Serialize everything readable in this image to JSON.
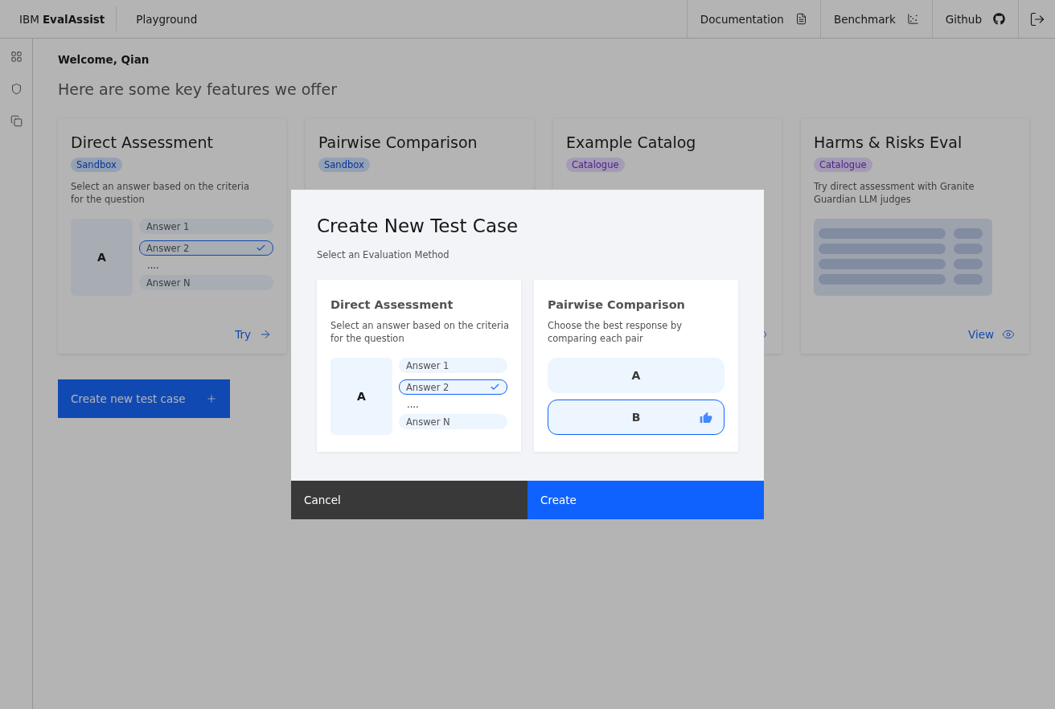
{
  "header": {
    "brand_prefix": "IBM",
    "brand_name": "EvalAssist",
    "nav": "Playground",
    "links": [
      {
        "label": "Documentation"
      },
      {
        "label": "Benchmark"
      },
      {
        "label": "Github"
      }
    ]
  },
  "sidebar": {
    "items": [
      {
        "selected": false
      },
      {
        "selected": false
      },
      {
        "selected": false
      }
    ]
  },
  "welcome": "Welcome, Qian",
  "subtitle": "Here are some key features we offer",
  "cards": [
    {
      "title": "Direct Assessment",
      "tag": {
        "label": "Sandbox",
        "kind": "sandbox"
      },
      "description": "Select an answer based on the criteria for the question",
      "preview": {
        "kind": "answers",
        "subject": "A",
        "answers_top": [
          {
            "label": "Answer 1",
            "selected": false
          },
          {
            "label": "Answer 2",
            "selected": true
          }
        ],
        "ellipsis": "....",
        "answers_bottom": [
          {
            "label": "Answer N",
            "selected": false
          }
        ]
      },
      "action": {
        "label": "Try",
        "kind": "try"
      }
    },
    {
      "title": "Pairwise Comparison",
      "tag": {
        "label": "Sandbox",
        "kind": "sandbox"
      }
    },
    {
      "title": "Example Catalog",
      "tag": {
        "label": "Catalogue",
        "kind": "catalogue"
      },
      "action": {
        "kind": "view"
      }
    },
    {
      "title": "Harms & Risks Eval",
      "tag": {
        "label": "Catalogue",
        "kind": "catalogue"
      },
      "description": "Try direct assessment with Granite Guardian LLM judges",
      "preview": {
        "kind": "table"
      },
      "action": {
        "label": "View",
        "kind": "view"
      }
    }
  ],
  "create_button": {
    "label": "Create new test case"
  },
  "dialog": {
    "title": "Create New Test Case",
    "subtitle": "Select an Evaluation Method",
    "options": [
      {
        "title": "Direct Assessment",
        "description": "Select an answer based on the criteria for the question",
        "selected": false,
        "preview": {
          "kind": "answers",
          "subject": "A",
          "answers_top": [
            {
              "label": "Answer 1",
              "selected": false
            },
            {
              "label": "Answer 2",
              "selected": true
            }
          ],
          "ellipsis": "....",
          "answers_bottom": [
            {
              "label": "Answer N",
              "selected": false
            }
          ]
        }
      },
      {
        "title": "Pairwise Comparison",
        "description": "Choose the best response by comparing each pair",
        "selected": false,
        "preview": {
          "kind": "pair",
          "choices": [
            {
              "label": "A",
              "selected": false
            },
            {
              "label": "B",
              "selected": true
            }
          ]
        }
      }
    ],
    "cancel": "Cancel",
    "confirm": "Create"
  }
}
